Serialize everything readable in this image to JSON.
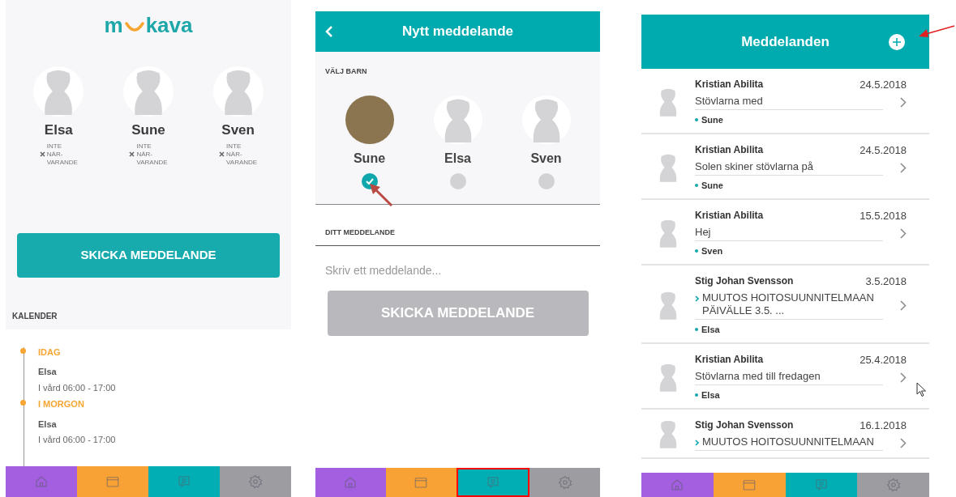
{
  "home_screen": {
    "logo": {
      "before": "m",
      "after": "kava"
    },
    "children": [
      {
        "name": "Elsa",
        "status_lines": [
          "INTE",
          "NÄR-",
          "VARANDE"
        ]
      },
      {
        "name": "Sune",
        "status_lines": [
          "INTE",
          "NÄR-",
          "VARANDE"
        ]
      },
      {
        "name": "Sven",
        "status_lines": [
          "INTE",
          "NÄR-",
          "VARANDE"
        ]
      }
    ],
    "send_button": "SKICKA MEDDELANDE",
    "calendar": {
      "heading": "KALENDER",
      "days": [
        {
          "label": "IDAG",
          "child": "Elsa",
          "detail": "I vård  06:00 - 17:00"
        },
        {
          "label": "I MORGON",
          "child": "Elsa",
          "detail": "I vård  06:00 - 17:00"
        }
      ]
    },
    "nav_tabs": [
      {
        "kind": "home",
        "color": "#a35fe0",
        "highlighted": false
      },
      {
        "kind": "calendar",
        "color": "#f8a134",
        "highlighted": false
      },
      {
        "kind": "messages",
        "color": "#00aeb3",
        "highlighted": false
      },
      {
        "kind": "settings",
        "color": "#9d9ca0",
        "highlighted": false
      }
    ]
  },
  "new_message_screen": {
    "title": "Nytt meddelande",
    "choose_heading": "VÄLJ BARN",
    "children": [
      {
        "name": "Sune",
        "photo": true,
        "selected": true
      },
      {
        "name": "Elsa",
        "photo": false,
        "selected": false
      },
      {
        "name": "Sven",
        "photo": false,
        "selected": false
      }
    ],
    "message_heading": "DITT MEDDELANDE",
    "message_field": {
      "placeholder": "Skriv ett meddelande..."
    },
    "send_button": {
      "label": "SKICKA MEDDELANDE",
      "disabled": true
    },
    "nav_tabs": [
      {
        "kind": "home",
        "color": "#a35fe0",
        "highlighted": false
      },
      {
        "kind": "calendar",
        "color": "#f8a134",
        "highlighted": false
      },
      {
        "kind": "messages",
        "color": "#00aeb3",
        "highlighted": true
      },
      {
        "kind": "settings",
        "color": "#9d9ca0",
        "highlighted": false
      }
    ]
  },
  "messages_screen": {
    "title": "Meddelanden",
    "messages": [
      {
        "sender": "Kristian Abilita",
        "date": "24.5.2018",
        "subject": "Stövlarna med",
        "forwarded": false,
        "child": "Sune"
      },
      {
        "sender": "Kristian Abilita",
        "date": "24.5.2018",
        "subject": "Solen skiner stövlarna på",
        "forwarded": false,
        "child": "Sune"
      },
      {
        "sender": "Kristian Abilita",
        "date": "15.5.2018",
        "subject": "Hej",
        "forwarded": false,
        "child": "Sven"
      },
      {
        "sender": "Stig Johan Svensson",
        "date": "3.5.2018",
        "subject": "MUUTOS HOITOSUUNNITELMAAN PÄIVÄLLE 3.5. ...",
        "forwarded": true,
        "child": "Elsa"
      },
      {
        "sender": "Kristian Abilita",
        "date": "25.4.2018",
        "subject": "Stövlarna med till fredagen",
        "forwarded": false,
        "child": "Elsa"
      },
      {
        "sender": "Stig Johan Svensson",
        "date": "16.1.2018",
        "subject": "MUUTOS HOITOSUUNNITELMAAN",
        "forwarded": true
      }
    ],
    "nav_tabs": [
      {
        "kind": "home",
        "color": "#a35fe0",
        "highlighted": false
      },
      {
        "kind": "calendar",
        "color": "#f8a134",
        "highlighted": false
      },
      {
        "kind": "messages",
        "color": "#00aeb3",
        "highlighted": false
      },
      {
        "kind": "settings",
        "color": "#9d9ca0",
        "highlighted": false
      }
    ]
  }
}
